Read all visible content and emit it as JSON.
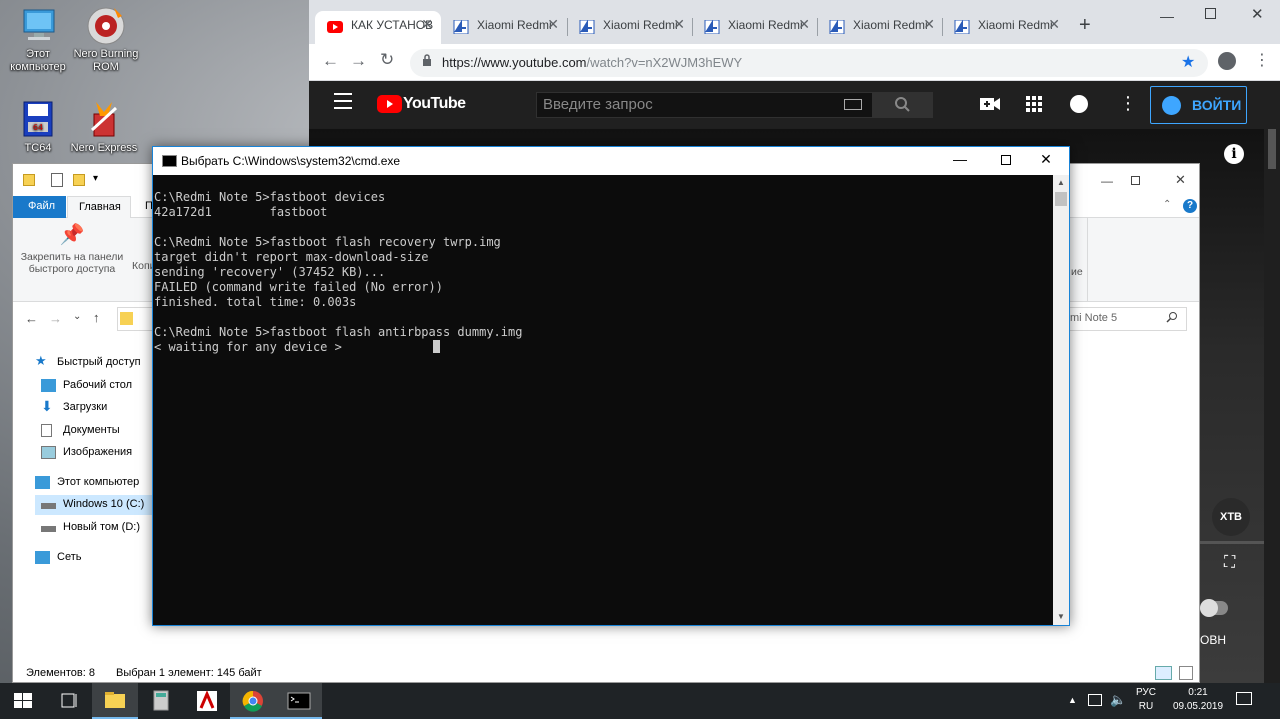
{
  "desktop": {
    "icons": [
      {
        "label_line1": "Этот",
        "label_line2": "компьютер",
        "icon": "this-pc-icon"
      },
      {
        "label_line1": "Nero Burning",
        "label_line2": "ROM",
        "icon": "nero-burning-rom-icon"
      },
      {
        "label_line1": "TC64",
        "label_line2": "",
        "icon": "total-commander-icon"
      },
      {
        "label_line1": "Nero Express",
        "label_line2": "",
        "icon": "nero-express-icon"
      }
    ]
  },
  "browser": {
    "tabs": [
      {
        "label": "КАК УСТАНОВ",
        "icon": "youtube-favicon",
        "active": true
      },
      {
        "label": "Xiaomi Redmi",
        "icon": "4pda-favicon"
      },
      {
        "label": "Xiaomi Redmi",
        "icon": "4pda-favicon"
      },
      {
        "label": "Xiaomi Redmi",
        "icon": "4pda-favicon"
      },
      {
        "label": "Xiaomi Redmi",
        "icon": "4pda-favicon"
      },
      {
        "label": "Xiaomi Redmi",
        "icon": "4pda-favicon"
      }
    ],
    "new_tab": "+",
    "url_host": "https://www.youtube.com",
    "url_path": "/watch?v=nX2WJM3hEWY",
    "youtube": {
      "logo": "YouTube",
      "search_placeholder": "Введите запрос",
      "signin_label": "ВОЙТИ",
      "channel_badge": "XTB",
      "partial_text": "ОВН"
    }
  },
  "explorer": {
    "tab_file": "Файл",
    "tab_home": "Главная",
    "tab_share_partial": "П",
    "pin_label_line1": "Закрепить на панели",
    "pin_label_line2": "быстрого доступа",
    "copy_partial": "Копи",
    "search_partial": "mi Note 5",
    "ribbon_partial": "ие",
    "sidebar": [
      {
        "label": "Быстрый доступ",
        "icon": "star-icon"
      },
      {
        "label": "Рабочий стол",
        "icon": "desktop-folder-icon"
      },
      {
        "label": "Загрузки",
        "icon": "downloads-icon"
      },
      {
        "label": "Документы",
        "icon": "documents-icon"
      },
      {
        "label": "Изображения",
        "icon": "pictures-icon"
      },
      {
        "label": "Этот компьютер",
        "icon": "this-pc-icon"
      },
      {
        "label": "Windows 10 (C:)",
        "icon": "drive-c-icon",
        "selected": true
      },
      {
        "label": "Новый том (D:)",
        "icon": "drive-d-icon"
      },
      {
        "label": "Сеть",
        "icon": "network-icon"
      }
    ],
    "status_items": "Элементов: 8",
    "status_selected": "Выбран 1 элемент: 145 байт"
  },
  "cmd": {
    "title": "Выбрать C:\\Windows\\system32\\cmd.exe",
    "lines": [
      "C:\\Redmi Note 5>fastboot devices",
      "42a172d1        fastboot",
      "",
      "C:\\Redmi Note 5>fastboot flash recovery twrp.img",
      "target didn't report max-download-size",
      "sending 'recovery' (37452 KB)...",
      "FAILED (command write failed (No error))",
      "finished. total time: 0.003s",
      "",
      "C:\\Redmi Note 5>fastboot flash antirbpass dummy.img",
      "< waiting for any device >"
    ]
  },
  "taskbar": {
    "lang_line1": "РУС",
    "lang_line2": "RU",
    "time": "0:21",
    "date": "09.05.2019"
  },
  "colors": {
    "accent": "#1979ca",
    "youtube_red": "#ff0000",
    "cmd_bg": "#0c0c0c",
    "cmd_fg": "#cccccc",
    "taskbar": "#1f2326"
  }
}
